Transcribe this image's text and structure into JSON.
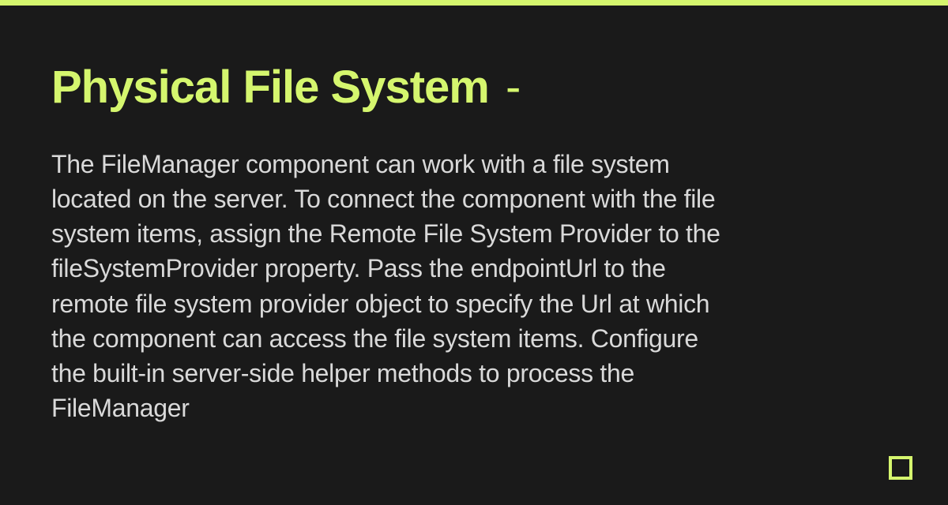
{
  "title": "Physical File System",
  "title_separator": "-",
  "body": "The FileManager component can work with a file system located on the server. To connect the component with the file system items, assign the Remote File System Provider to the fileSystemProvider property. Pass the endpointUrl to the remote file system provider object to specify the Url at which the component can access the file system items. Configure the built-in server-side helper methods to process the FileManager",
  "colors": {
    "accent": "#d5f66e",
    "background": "#1a1a1a",
    "text": "#d9d9d9"
  }
}
